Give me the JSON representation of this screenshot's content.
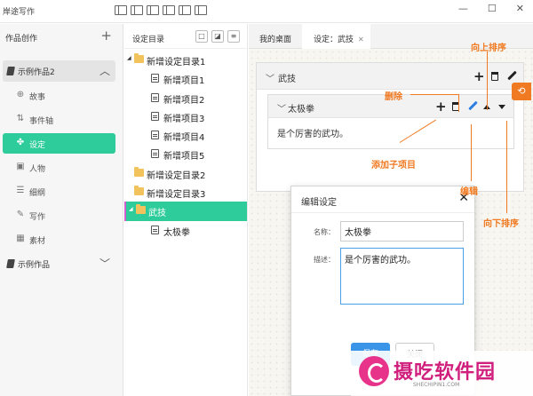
{
  "titlebar": {
    "app_title": "岸途写作",
    "toolbar_icons": [
      "layout-1-icon",
      "layout-2-icon",
      "layout-3-icon",
      "layout-4-icon",
      "help-icon",
      "monitor-icon"
    ],
    "minimize": "—",
    "maximize": "☐",
    "close": "✕"
  },
  "left": {
    "header": "作品创作",
    "add": "+",
    "work1": "示例作品2",
    "nav": [
      {
        "label": "故事",
        "icon": "⊕"
      },
      {
        "label": "事件轴",
        "icon": "⇅"
      },
      {
        "label": "设定",
        "icon": "✤"
      },
      {
        "label": "人物",
        "icon": "▣"
      },
      {
        "label": "细纲",
        "icon": "☰"
      },
      {
        "label": "写作",
        "icon": "✎"
      },
      {
        "label": "素材",
        "icon": "▦"
      }
    ],
    "work2": "示例作品",
    "chev_up": "︿",
    "chev_down": "﹀"
  },
  "settings_tree": {
    "header": "设定目录",
    "buttons": [
      "□",
      "◪",
      "≡"
    ],
    "nodes": [
      {
        "label": "新增设定目录1",
        "type": "folder",
        "open": true
      },
      {
        "label": "新增项目1",
        "type": "item"
      },
      {
        "label": "新增项目2",
        "type": "item"
      },
      {
        "label": "新增项目3",
        "type": "item"
      },
      {
        "label": "新增项目4",
        "type": "item"
      },
      {
        "label": "新增项目5",
        "type": "item"
      },
      {
        "label": "新增设定目录2",
        "type": "folder"
      },
      {
        "label": "新增设定目录3",
        "type": "folder"
      },
      {
        "label": "武技",
        "type": "folder",
        "open": true,
        "selected": true
      },
      {
        "label": "太极拳",
        "type": "item"
      }
    ]
  },
  "tabs": {
    "desktop": "我的桌面",
    "setting": "设定：武技",
    "close": "✕"
  },
  "category_card": {
    "title": "武技"
  },
  "item_card": {
    "title": "太极拳",
    "description": "是个厉害的武功。"
  },
  "refresh_icon": "⟲",
  "dialog": {
    "title": "编辑设定",
    "close": "✕",
    "name_label": "名称：",
    "name_value": "太极拳",
    "desc_label": "描述：",
    "desc_value": "是个厉害的武功。",
    "save": "保存",
    "cancel": "关闭"
  },
  "annotations": {
    "move_up": "向上排序",
    "delete": "删除",
    "add_child": "添加子项目",
    "edit": "编辑",
    "move_down": "向下排序"
  },
  "watermark": {
    "name": "摄吃软件园",
    "url": "SHECHIPIN1.COM"
  },
  "colors": {
    "accent": "#2ecc9a",
    "annotation": "#f07a22",
    "primary_button": "#3a95e8"
  }
}
